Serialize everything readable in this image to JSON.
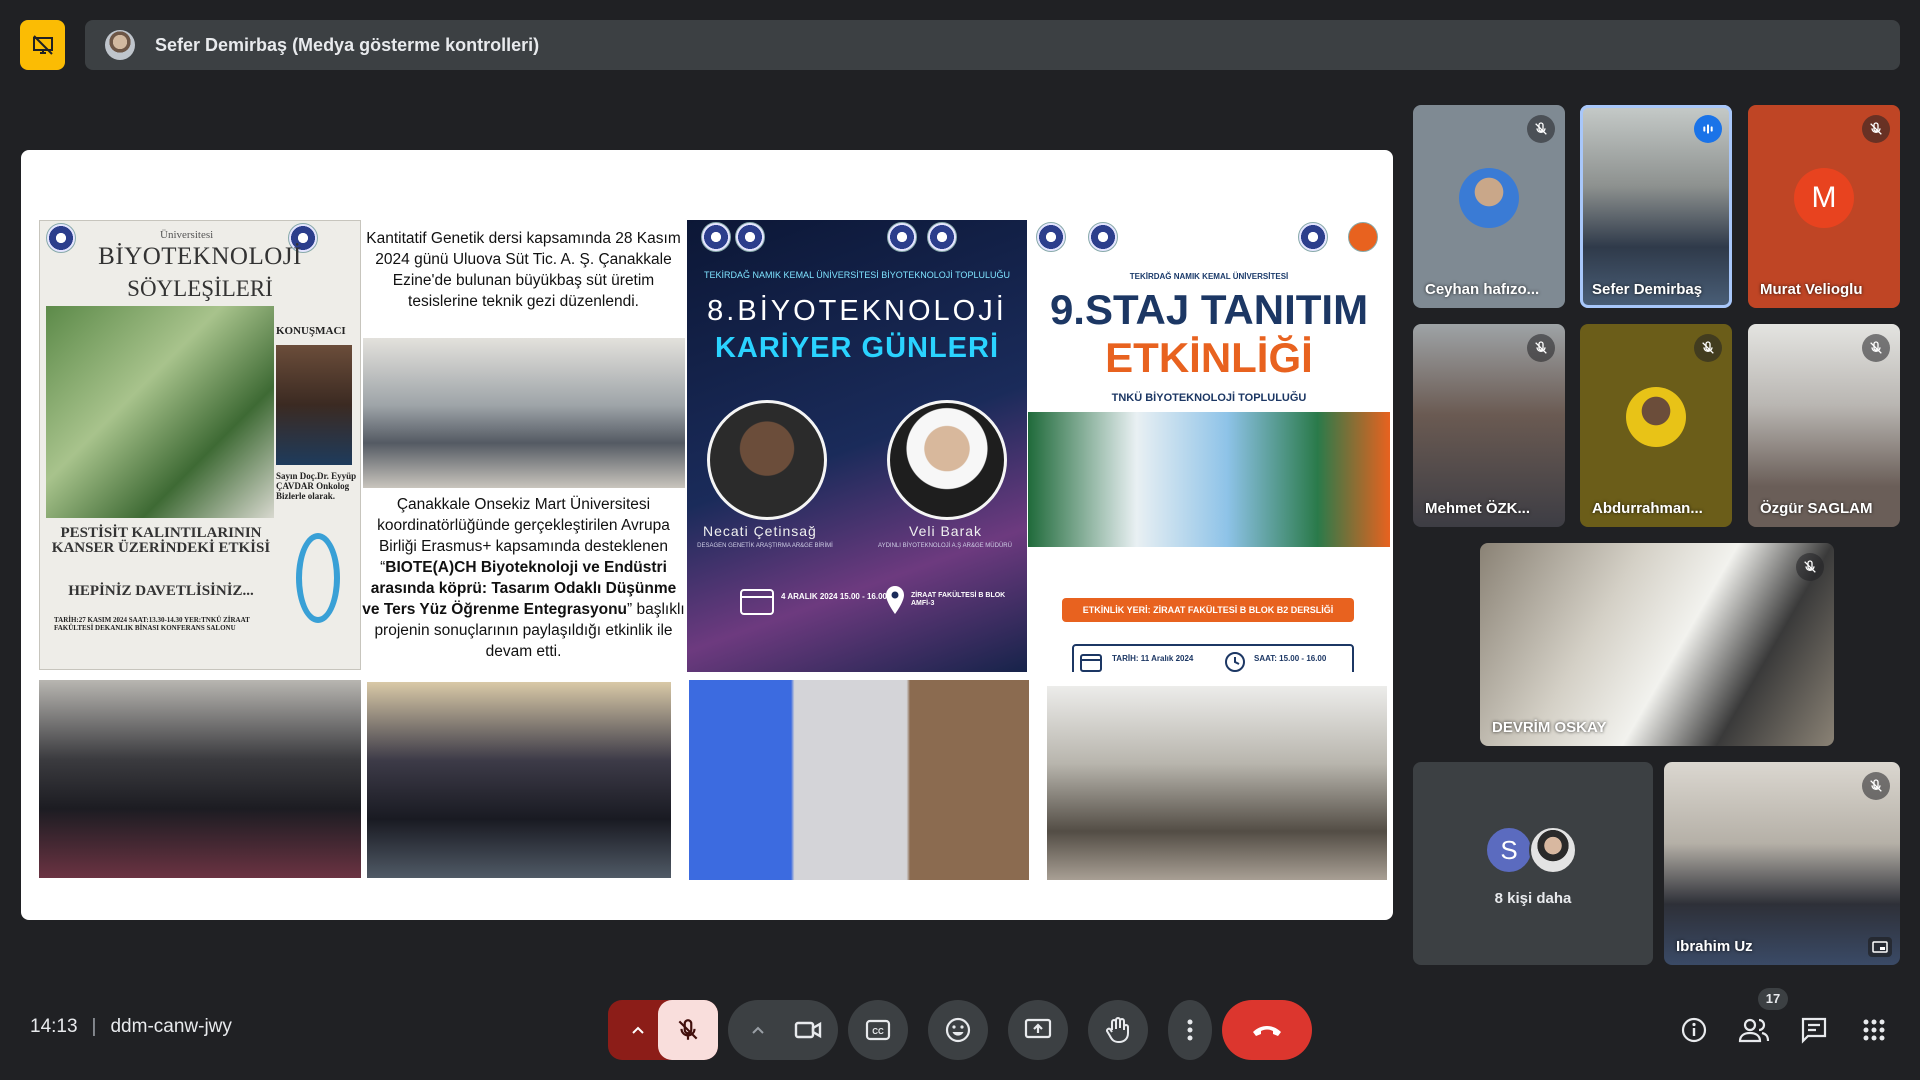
{
  "presenter": {
    "name": "Sefer Demirbaş (Medya gösterme kontrolleri)"
  },
  "slide": {
    "poster1": {
      "brand_top": "Üniversitesi",
      "title_line1": "BİYOTEKNOLOJİ",
      "title_line2": "SÖYLEŞİLERİ",
      "speaker_heading": "KONUŞMACI",
      "speaker_info": "Sayın Doç.Dr. Eyyüp ÇAVDAR Onkolog Bizlerle olarak.",
      "main_title": "PESTİSİT KALINTILARININ KANSER ÜZERİNDEKİ ETKİSİ",
      "invite": "HEPİNİZ DAVETLİSİNİZ...",
      "details": "TARİH:27 KASIM 2024 SAAT:13.30-14.30 YER:TNKÜ ZİRAAT FAKÜLTESİ DEKANLIK BİNASI KONFERANS SALONU"
    },
    "text1": "Kantitatif Genetik dersi kapsamında 28 Kasım 2024 günü Uluova Süt Tic. A. Ş. Çanakkale Ezine'de bulunan büyükbaş süt üretim tesislerine teknik gezi düzenlendi.",
    "text2": {
      "part1": "Çanakkale Onsekiz Mart Üniversitesi koordinatörlüğünde gerçekleştirilen Avrupa Birliği Erasmus+ kapsamında desteklenen “",
      "bold": "BIOTE(A)CH Biyoteknoloji ve Endüstri arasında köprü: Tasarım Odaklı Düşünme ve Ters Yüz Öğrenme Entegrasyonu",
      "part2": "” başlıklı projenin sonuçlarının paylaşıldığı etkinlik ile devam etti."
    },
    "poster3": {
      "sup": "TEKİRDAĞ NAMIK KEMAL ÜNİVERSİTESİ BİYOTEKNOLOJİ TOPLULUĞU",
      "title_line1": "8.BİYOTEKNOLOJİ",
      "title_line2": "KARİYER GÜNLERİ",
      "speaker1": "Necati Çetinsağ",
      "speaker1_role": "DESAGEN GENETİK ARAŞTIRMA AR&GE BİRİMİ",
      "speaker2": "Veli Barak",
      "speaker2_role": "AYDINLI BİYOTEKNOLOJİ A.Ş AR&GE MÜDÜRÜ",
      "date": "4 ARALIK 2024 15.00 - 16.00",
      "location": "ZİRAAT FAKÜLTESİ B BLOK AMFİ-3"
    },
    "poster4": {
      "sup": "TEKİRDAĞ NAMIK KEMAL ÜNİVERSİTESİ",
      "title_line1": "9.STAJ TANITIM",
      "title_line2": "ETKİNLİĞİ",
      "subtitle": "TNKÜ BİYOTEKNOLOJİ TOPLULUĞU",
      "location": "ETKİNLİK YERİ: ZİRAAT FAKÜLTESİ B BLOK B2 DERSLİĞİ",
      "date": "TARİH: 11 Aralık 2024",
      "time": "SAAT: 15.00 - 16.00"
    }
  },
  "participants": [
    {
      "name": "Ceyhan hafızo...",
      "muted": true
    },
    {
      "name": "Sefer Demirbaş",
      "speaking": true
    },
    {
      "name": "Murat Velioglu",
      "initial": "M",
      "muted": true
    },
    {
      "name": "Mehmet ÖZK...",
      "muted": true
    },
    {
      "name": "Abdurrahman...",
      "muted": true
    },
    {
      "name": "Özgür SAGLAM",
      "muted": true
    },
    {
      "name": "DEVRİM OSKAY",
      "muted": true
    },
    {
      "name": "Ibrahim Uz",
      "muted": true
    }
  ],
  "more_participants": {
    "initial": "S",
    "label": "8 kişi daha"
  },
  "meeting": {
    "time": "14:13",
    "code": "ddm-canw-jwy"
  },
  "people_count": "17",
  "colors": {
    "background": "#202124",
    "surface": "#3c4043",
    "hangup": "#dc362e",
    "mic_off_bg": "#f9dedc",
    "present_accent": "#fbbc04",
    "murat_tile": "#bf4525"
  }
}
